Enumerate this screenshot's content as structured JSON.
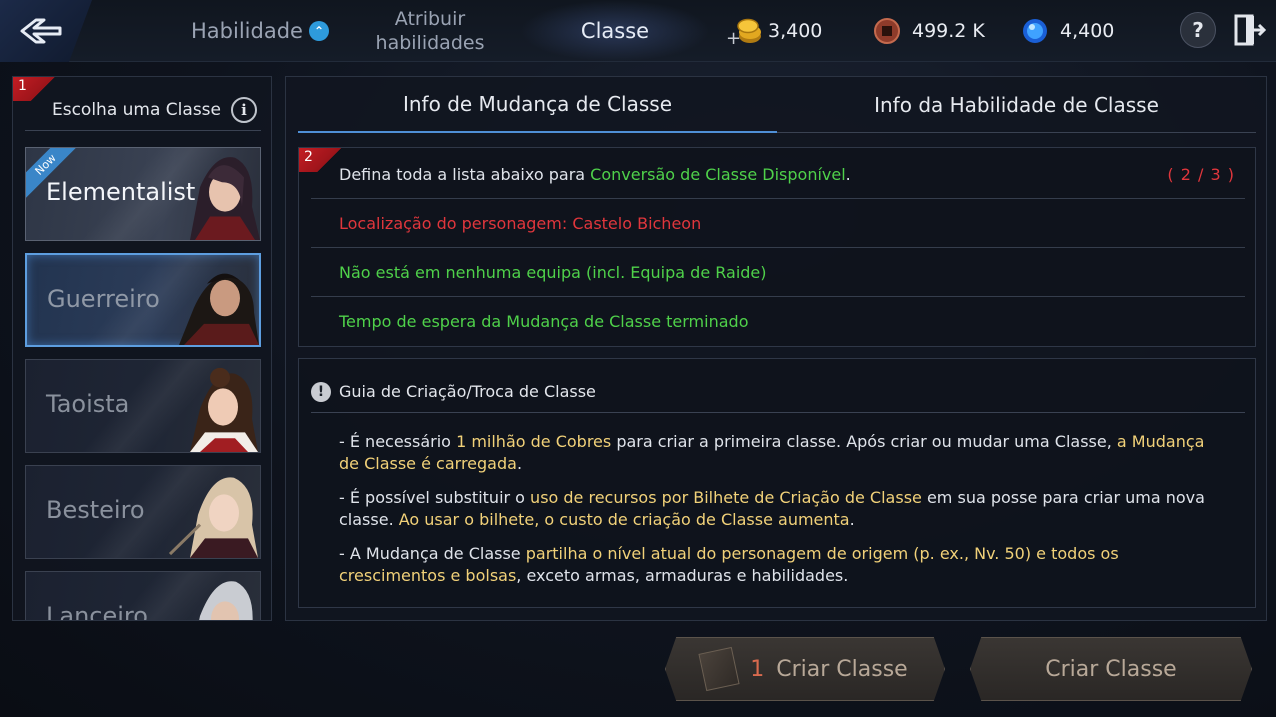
{
  "topbar": {
    "tabs": [
      {
        "label": "Habilidade"
      },
      {
        "label": "Atribuir habilidades"
      },
      {
        "label": "Classe"
      }
    ],
    "currencies": [
      {
        "name": "gold-coins",
        "value": "3,400"
      },
      {
        "name": "copper-coins",
        "value": "499.2 K"
      },
      {
        "name": "blue-gems",
        "value": "4,400"
      }
    ],
    "help_label": "?"
  },
  "left_panel": {
    "badge": "1",
    "title": "Escolha uma Classe",
    "info_icon": "i",
    "classes": [
      {
        "name": "Elementalist",
        "tag": "Now"
      },
      {
        "name": "Guerreiro"
      },
      {
        "name": "Taoista"
      },
      {
        "name": "Besteiro"
      },
      {
        "name": "Lanceiro"
      }
    ]
  },
  "right_panel": {
    "tabs": [
      "Info de Mudança de Classe",
      "Info da Habilidade de Classe"
    ],
    "requirements": {
      "badge": "2",
      "intro_prefix": "Defina toda a lista abaixo para ",
      "intro_highlight": "Conversão de Classe Disponível",
      "intro_suffix": ".",
      "count": "( 2 / 3 )",
      "items": [
        {
          "text": "Localização do personagem: Castelo Bicheon",
          "status": "red"
        },
        {
          "text": "Não está em nenhuma equipa (incl. Equipa de Raide)",
          "status": "green"
        },
        {
          "text": "Tempo de espera da Mudança de Classe terminado",
          "status": "green"
        }
      ]
    },
    "guide": {
      "title": "Guia de Criação/Troca de Classe",
      "paragraphs": [
        {
          "p1": "- É necessário ",
          "h1": "1 milhão de Cobres",
          "p2": " para criar a primeira classe. Após criar ou mudar uma Classe, ",
          "h2": "a Mudança de Classe é carregada",
          "p3": "."
        },
        {
          "p1": "- É possível substituir o ",
          "h1": "uso de recursos por Bilhete de Criação de Classe",
          "p2": " em sua posse para criar uma nova classe. ",
          "h2": "Ao usar o bilhete, o custo de criação de Classe aumenta",
          "p3": "."
        },
        {
          "p1": "- A Mudança de Classe ",
          "h1": "partilha o nível atual do personagem de origem (p. ex., Nv. 50) e todos os crescimentos e bolsas",
          "p2": ", exceto armas, armaduras e habilidades.",
          "h2": "",
          "p3": ""
        }
      ]
    }
  },
  "buttons": {
    "ticket_count": "1",
    "ticket_label": "Criar Classe",
    "create_label": "Criar Classe"
  },
  "colors": {
    "green": "#4fd14a",
    "red": "#e0363c",
    "yellow_highlight": "#f1d179",
    "tab_underline": "#4f8fd6",
    "badge_red": "#c41d24"
  }
}
